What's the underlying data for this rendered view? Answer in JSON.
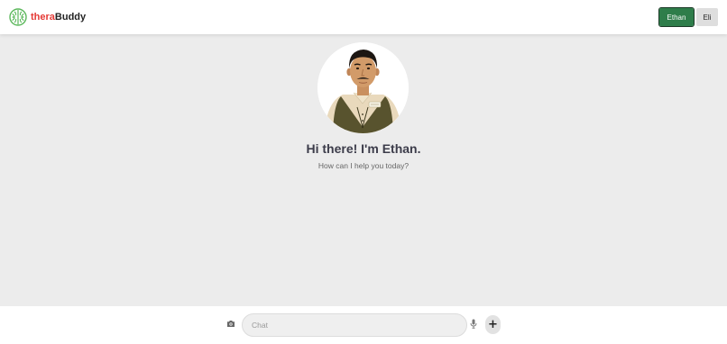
{
  "header": {
    "brand_prefix": "thera",
    "brand_suffix": "Buddy",
    "logo_icon": "brain-icon",
    "personas": [
      {
        "label": "Ethan",
        "active": true
      },
      {
        "label": "Eli",
        "active": false
      }
    ]
  },
  "main": {
    "avatar_icon": "ethan-avatar",
    "greeting": "Hi there! I'm Ethan.",
    "subtext": "How can I help you today?"
  },
  "composer": {
    "placeholder": "Chat",
    "value": "",
    "camera_icon": "camera-icon",
    "mic_icon": "microphone-icon",
    "plus_label": "+"
  },
  "colors": {
    "accent": "#2e7d4a",
    "brand_red": "#e53935",
    "logo_green": "#5cb85c",
    "background": "#ececec"
  }
}
